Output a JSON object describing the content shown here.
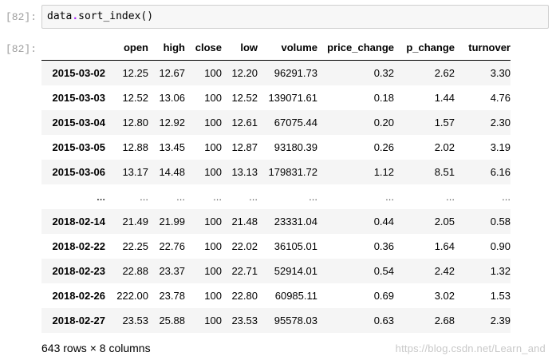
{
  "notebook": {
    "input_prompt": "[82]:",
    "output_prompt": "[82]:",
    "code": {
      "object": "data",
      "dot": ".",
      "method": "sort_index",
      "args": "()"
    }
  },
  "dataframe": {
    "columns": [
      "open",
      "high",
      "close",
      "low",
      "volume",
      "price_change",
      "p_change",
      "turnover"
    ],
    "rows": [
      {
        "index": "2015-03-02",
        "values": [
          "12.25",
          "12.67",
          "100",
          "12.20",
          "96291.73",
          "0.32",
          "2.62",
          "3.30"
        ]
      },
      {
        "index": "2015-03-03",
        "values": [
          "12.52",
          "13.06",
          "100",
          "12.52",
          "139071.61",
          "0.18",
          "1.44",
          "4.76"
        ]
      },
      {
        "index": "2015-03-04",
        "values": [
          "12.80",
          "12.92",
          "100",
          "12.61",
          "67075.44",
          "0.20",
          "1.57",
          "2.30"
        ]
      },
      {
        "index": "2015-03-05",
        "values": [
          "12.88",
          "13.45",
          "100",
          "12.87",
          "93180.39",
          "0.26",
          "2.02",
          "3.19"
        ]
      },
      {
        "index": "2015-03-06",
        "values": [
          "13.17",
          "14.48",
          "100",
          "13.13",
          "179831.72",
          "1.12",
          "8.51",
          "6.16"
        ]
      },
      {
        "index": "...",
        "values": [
          "...",
          "...",
          "...",
          "...",
          "...",
          "...",
          "...",
          "..."
        ]
      },
      {
        "index": "2018-02-14",
        "values": [
          "21.49",
          "21.99",
          "100",
          "21.48",
          "23331.04",
          "0.44",
          "2.05",
          "0.58"
        ]
      },
      {
        "index": "2018-02-22",
        "values": [
          "22.25",
          "22.76",
          "100",
          "22.02",
          "36105.01",
          "0.36",
          "1.64",
          "0.90"
        ]
      },
      {
        "index": "2018-02-23",
        "values": [
          "22.88",
          "23.37",
          "100",
          "22.71",
          "52914.01",
          "0.54",
          "2.42",
          "1.32"
        ]
      },
      {
        "index": "2018-02-26",
        "values": [
          "222.00",
          "23.78",
          "100",
          "22.80",
          "60985.11",
          "0.69",
          "3.02",
          "1.53"
        ]
      },
      {
        "index": "2018-02-27",
        "values": [
          "23.53",
          "25.88",
          "100",
          "23.53",
          "95578.03",
          "0.63",
          "2.68",
          "2.39"
        ]
      }
    ],
    "shape_text": "643 rows × 8 columns"
  },
  "watermark": "https://blog.csdn.net/Learn_and"
}
